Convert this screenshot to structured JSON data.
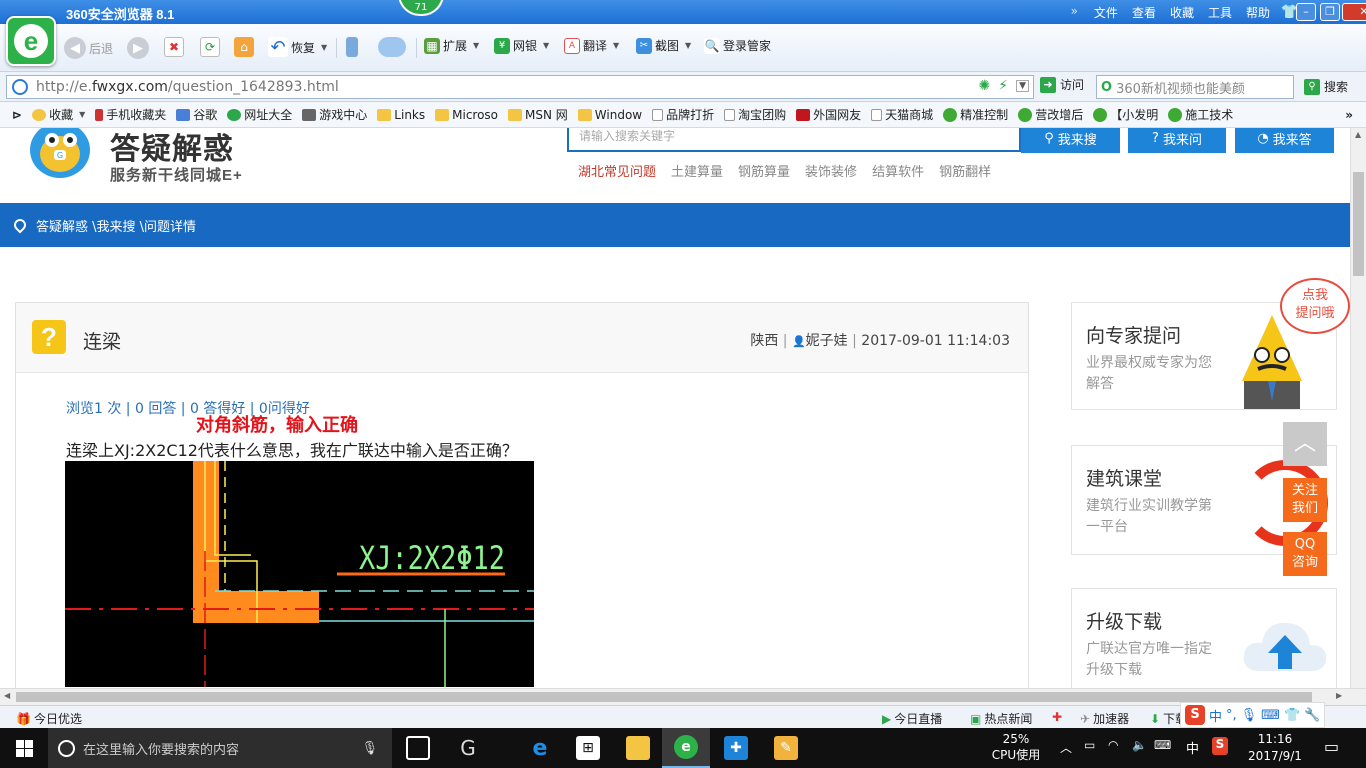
{
  "browser": {
    "title": "360安全浏览器 8.1",
    "score": "71",
    "menu": [
      "文件",
      "查看",
      "收藏",
      "工具",
      "帮助"
    ],
    "back_label": "后退",
    "restore_label": "恢复",
    "extend_label": "扩展",
    "bank_label": "网银",
    "translate_label": "翻译",
    "screenshot_label": "截图",
    "login_label": "登录管家",
    "url": "http://e.fwxgx.com/question_1642893.html",
    "url_prefix": "http://e.",
    "url_domain": "fwxgx.com",
    "url_path": "/question_1642893.html",
    "goto_label": "访问",
    "search_placeholder": "360新机视频也能美颜",
    "search_label": "搜索",
    "favorites": [
      "收藏",
      "手机收藏夹",
      "谷歌",
      "网址大全",
      "游戏中心",
      "Links",
      "Microso",
      "MSN 网",
      "Window",
      "品牌打折",
      "淘宝团购",
      "外国网友",
      "天猫商城",
      "精准控制",
      "营改增后",
      "【小发明",
      "施工技术"
    ]
  },
  "site": {
    "name": "答疑解惑",
    "slogan": "服务新干线同城E+",
    "search_placeholder": "请输入搜索关键字",
    "btn_search": "我来搜",
    "btn_ask": "我来问",
    "btn_answer": "我来答",
    "hot_links": [
      "湖北常见问题",
      "土建算量",
      "钢筋算量",
      "装饰装修",
      "结算软件",
      "钢筋翻样"
    ],
    "breadcrumb": "答疑解惑 \\我来搜 \\问题详情"
  },
  "question": {
    "title": "连梁",
    "province": "陕西",
    "user": "妮子娃",
    "datetime": "2017-09-01 11:14:03",
    "stats": "浏览1 次 | 0 回答 | 0 答得好 | 0问得好",
    "annotation": "对角斜筋，输入正确",
    "body": "连梁上XJ:2X2C12代表什么意思，我在广联达中输入是否正确？",
    "cad_label": "XJ:2X2Φ12"
  },
  "sidebar": {
    "bubble_line1": "点我",
    "bubble_line2": "提问哦",
    "cards": [
      {
        "title": "向专家提问",
        "desc": "业界最权威专家为您解答"
      },
      {
        "title": "建筑课堂",
        "desc": "建筑行业实训教学第一平台"
      },
      {
        "title": "升级下载",
        "desc": "广联达官方唯一指定升级下载"
      }
    ],
    "follow_label_1": "关注",
    "follow_label_2": "我们",
    "qq_label_1": "QQ",
    "qq_label_2": "咨询"
  },
  "statusbar": {
    "today_pick": "今日优选",
    "live": "今日直播",
    "hot_news": "热点新闻",
    "accelerator": "加速器",
    "download": "下载",
    "ime_lang": "中"
  },
  "taskbar": {
    "search_placeholder": "在这里输入你要搜索的内容",
    "cpu_percent": "25%",
    "cpu_label": "CPU使用",
    "ime": "中",
    "time": "11:16",
    "date": "2017/9/1"
  },
  "colors": {
    "brand_blue": "#1769c1",
    "button_blue": "#1e84d8",
    "annotation_red": "#e3141b",
    "question_yellow": "#f5c518",
    "float_orange": "#f56a1b",
    "cad_orange": "#ff8a1e",
    "cad_green": "#8ef58e"
  }
}
